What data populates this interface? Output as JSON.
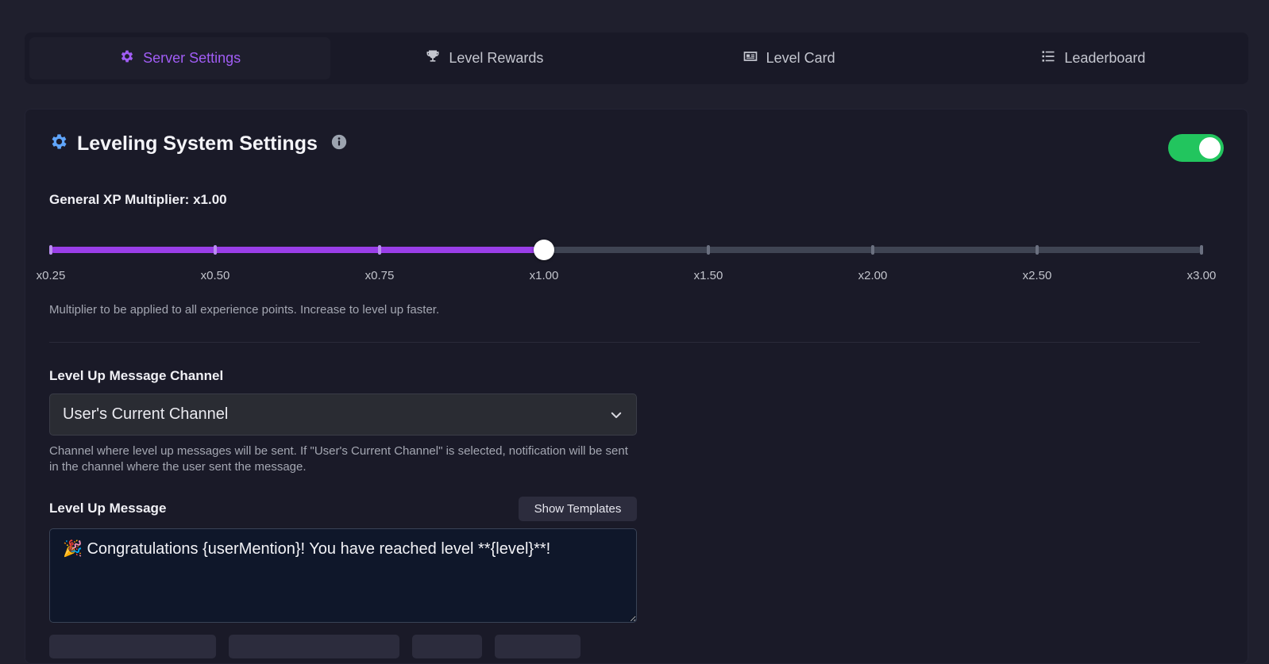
{
  "tabs": [
    {
      "label": "Server Settings",
      "icon": "gear-icon",
      "active": true
    },
    {
      "label": "Level Rewards",
      "icon": "trophy-icon",
      "active": false
    },
    {
      "label": "Level Card",
      "icon": "id-card-icon",
      "active": false
    },
    {
      "label": "Leaderboard",
      "icon": "list-icon",
      "active": false
    }
  ],
  "card": {
    "title": "Leveling System Settings",
    "enabled": true
  },
  "multiplier": {
    "label": "General XP Multiplier: x1.00",
    "value": 1.0,
    "ticks": [
      "x0.25",
      "x0.50",
      "x0.75",
      "x1.00",
      "x1.50",
      "x2.00",
      "x2.50",
      "x3.00"
    ],
    "selected_index": 3,
    "help": "Multiplier to be applied to all experience points. Increase to level up faster."
  },
  "channel": {
    "label": "Level Up Message Channel",
    "selected": "User's Current Channel",
    "help": "Channel where level up messages will be sent. If \"User's Current Channel\" is selected, notification will be sent in the channel where the user sent the message."
  },
  "message": {
    "label": "Level Up Message",
    "templates_button": "Show Templates",
    "value": "🎉 Congratulations {userMention}! You have reached level **{level}**!"
  },
  "colors": {
    "accent": "#a15df5",
    "toggle_on": "#22c55e",
    "slider_fill": "#9a3ee8",
    "gear_blue": "#60a5fa"
  }
}
